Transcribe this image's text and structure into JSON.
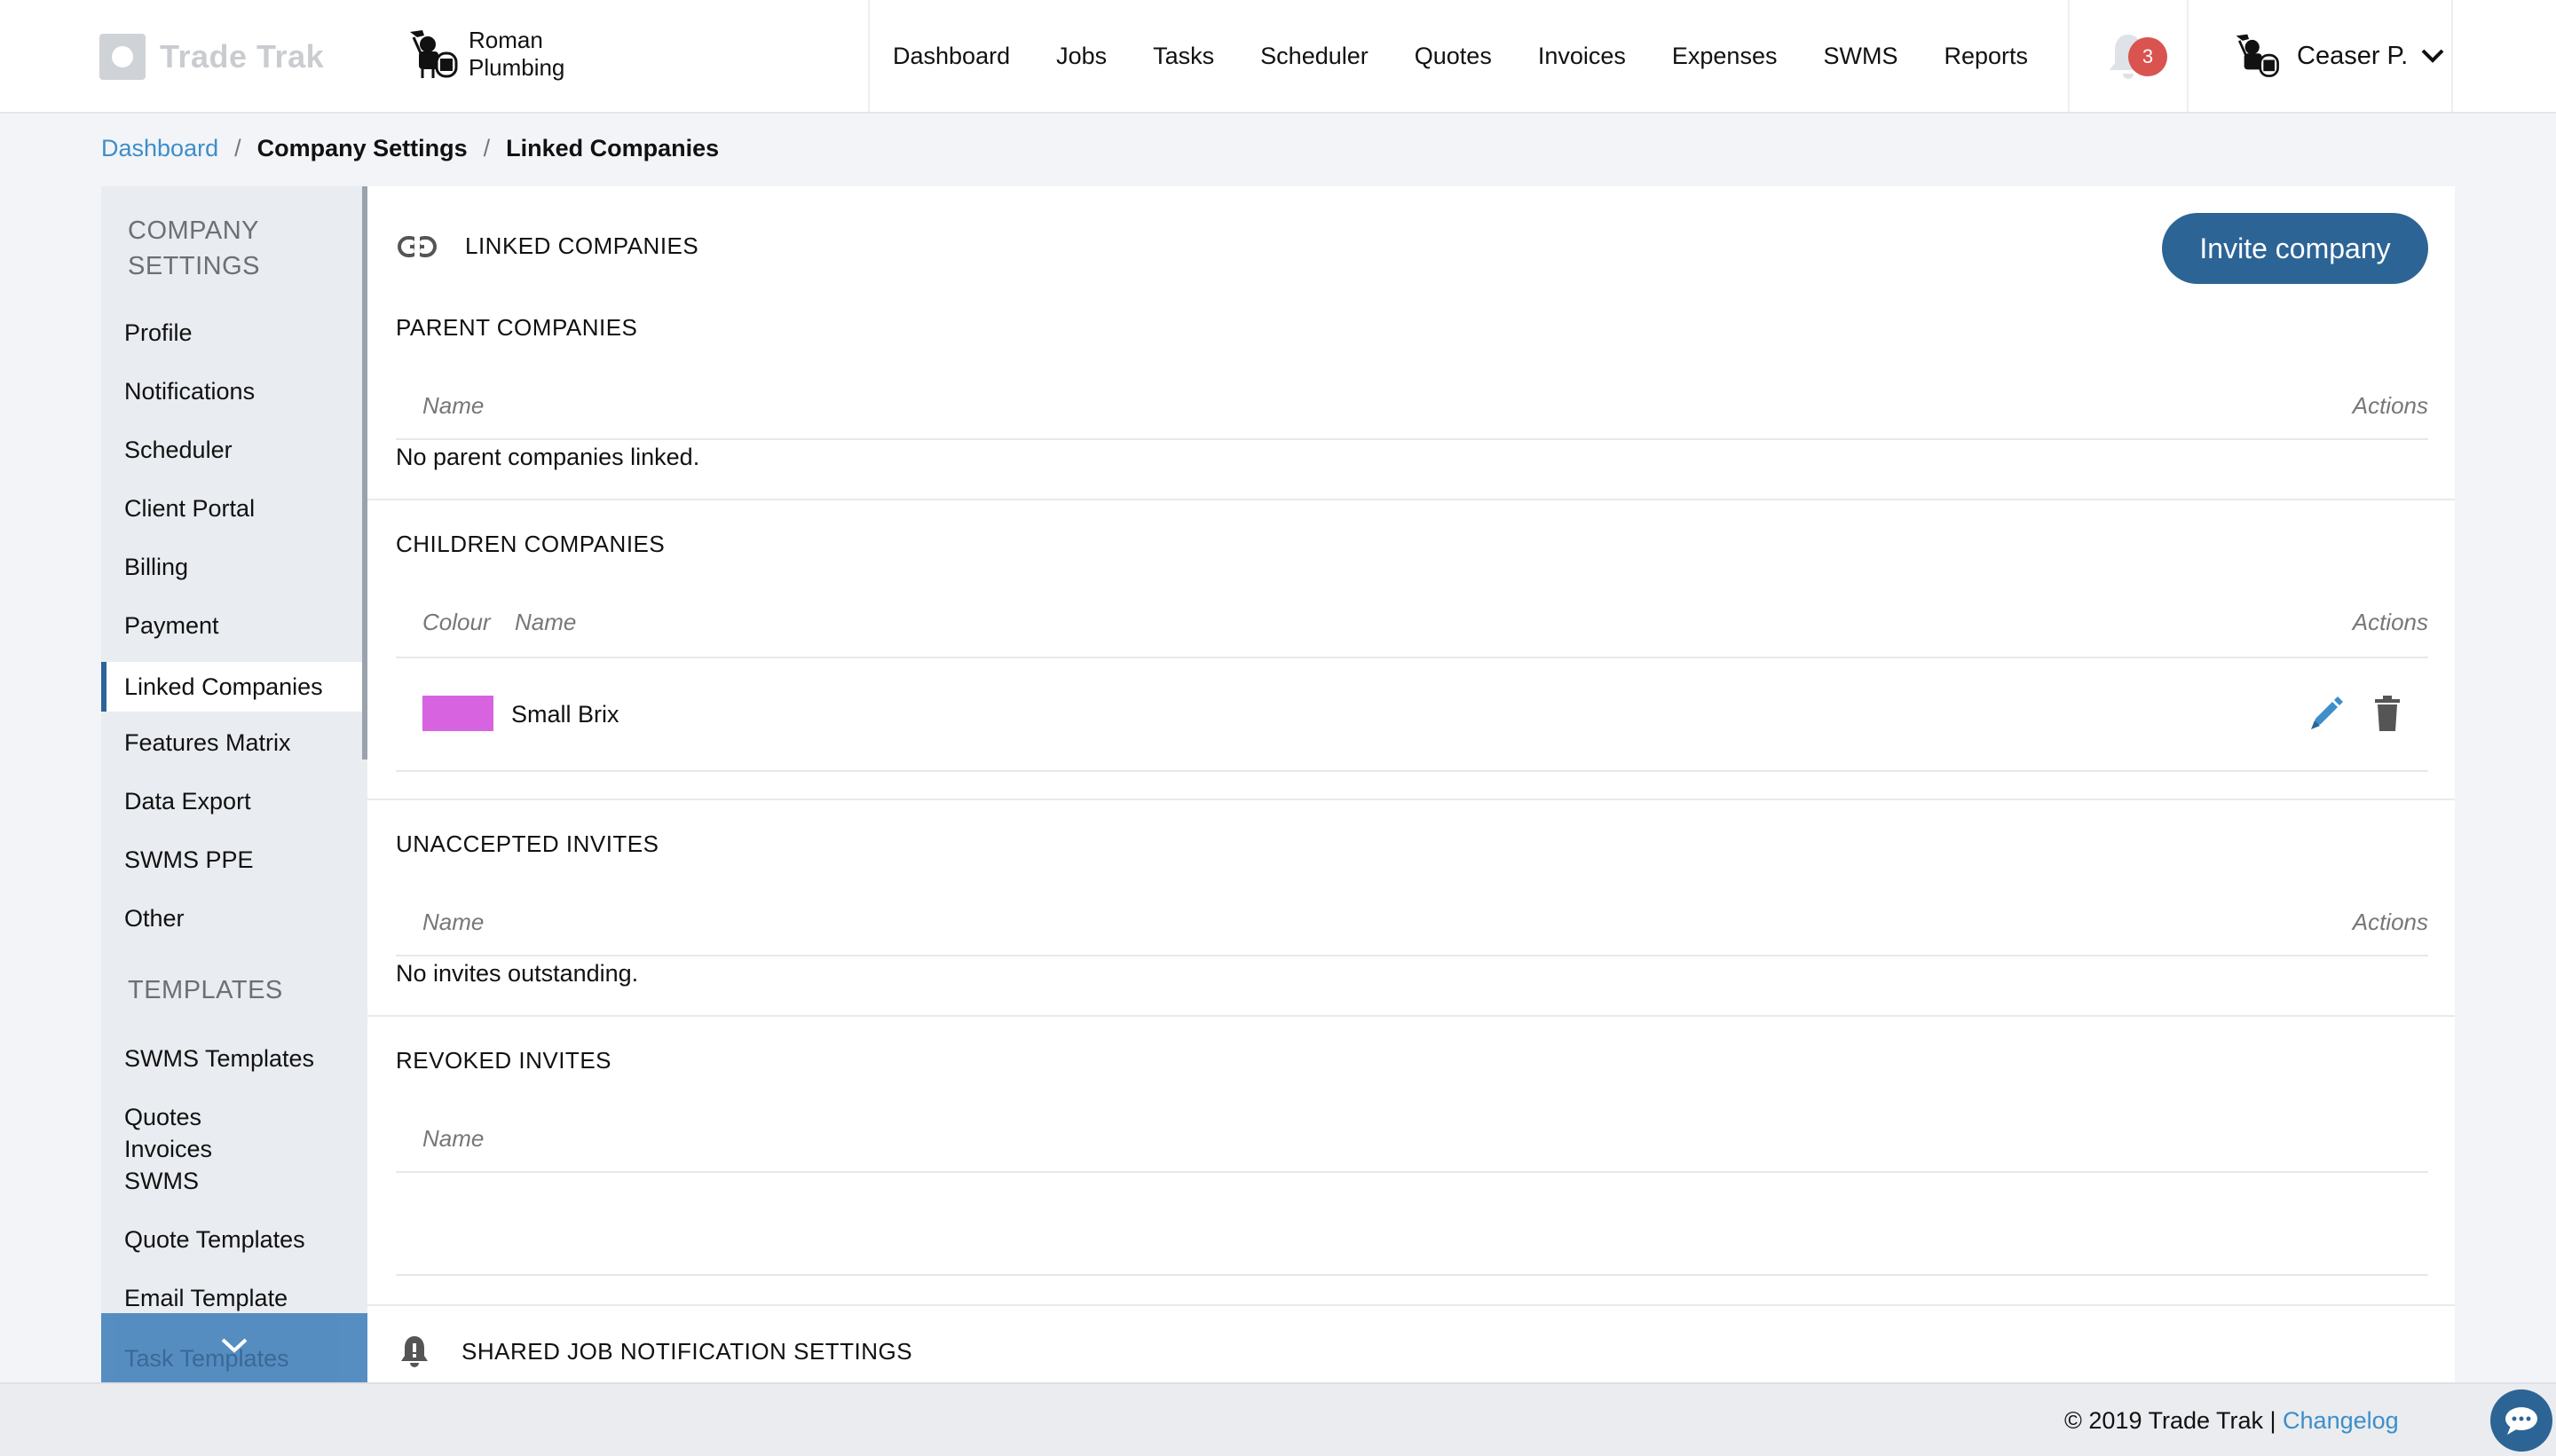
{
  "brand": {
    "name": "Trade Trak"
  },
  "company": {
    "name_line1": "Roman",
    "name_line2": "Plumbing"
  },
  "nav": {
    "items": [
      "Dashboard",
      "Jobs",
      "Tasks",
      "Scheduler",
      "Quotes",
      "Invoices",
      "Expenses",
      "SWMS",
      "Reports"
    ]
  },
  "notifications": {
    "count": "3"
  },
  "user": {
    "name": "Ceaser P."
  },
  "breadcrumb": {
    "root": "Dashboard",
    "sep": "/",
    "parent": "Company Settings",
    "current": "Linked Companies"
  },
  "sidebar": {
    "settings_heading_1": "COMPANY",
    "settings_heading_2": "SETTINGS",
    "settings_items": [
      "Profile",
      "Notifications",
      "Scheduler",
      "Client Portal",
      "Billing",
      "Payment",
      "Linked Companies",
      "Features Matrix",
      "Data Export",
      "SWMS PPE",
      "Other"
    ],
    "active_item": "Linked Companies",
    "templates_heading": "TEMPLATES",
    "template_items": [
      "SWMS Templates",
      "Quotes",
      "Invoices",
      "SWMS",
      "Quote Templates",
      "Email Template",
      "Task Templates"
    ]
  },
  "main": {
    "title": "LINKED COMPANIES",
    "invite_button": "Invite company",
    "parent": {
      "title": "PARENT COMPANIES",
      "col_name": "Name",
      "col_actions": "Actions",
      "empty": "No parent companies linked."
    },
    "children": {
      "title": "CHILDREN COMPANIES",
      "col_colour": "Colour",
      "col_name": "Name",
      "col_actions": "Actions",
      "rows": [
        {
          "name": "Small Brix",
          "colour": "#d863e0"
        }
      ]
    },
    "unaccepted": {
      "title": "UNACCEPTED INVITES",
      "col_name": "Name",
      "col_actions": "Actions",
      "empty": "No invites outstanding."
    },
    "revoked": {
      "title": "REVOKED INVITES",
      "col_name": "Name"
    },
    "shared_notifications": {
      "title": "SHARED JOB NOTIFICATION SETTINGS"
    }
  },
  "footer": {
    "copyright": "© 2019 Trade Trak |",
    "changelog": "Changelog"
  },
  "colors": {
    "primary": "#2c6496",
    "link": "#3d8ec9",
    "badge": "#d9534f",
    "sidebar_bg": "#e9ecf0"
  },
  "icons": {
    "link": "link-icon",
    "bell": "bell-icon",
    "edit": "pencil-icon",
    "delete": "trash-icon",
    "chat": "chat-icon"
  }
}
